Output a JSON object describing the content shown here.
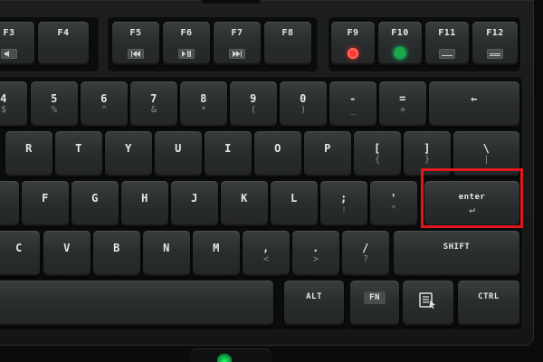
{
  "highlight_target": "enter-key",
  "colors": {
    "highlight": "#e3161d",
    "led_red": "#ff3a30",
    "led_green": "#1aa84a",
    "logo": "#21ff6a"
  },
  "keys": {
    "f3": {
      "label": "F3",
      "icon": "volume-down-icon"
    },
    "f4": {
      "label": "F4"
    },
    "f5": {
      "label": "F5",
      "icon": "previous-track-icon"
    },
    "f6": {
      "label": "F6",
      "icon": "play-pause-icon"
    },
    "f7": {
      "label": "F7",
      "icon": "next-track-icon"
    },
    "f8": {
      "label": "F8"
    },
    "f9": {
      "label": "F9",
      "icon": "record-icon"
    },
    "f10": {
      "label": "F10",
      "icon": "crosshair-icon"
    },
    "f11": {
      "label": "F11",
      "icon": "brightness-down-icon"
    },
    "f12": {
      "label": "F12",
      "icon": "brightness-up-icon"
    },
    "n4": {
      "label": "4",
      "sub": "$"
    },
    "n5": {
      "label": "5",
      "sub": "%"
    },
    "n6": {
      "label": "6",
      "sub": "^"
    },
    "n7": {
      "label": "7",
      "sub": "&"
    },
    "n8": {
      "label": "8",
      "sub": "*"
    },
    "n9": {
      "label": "9",
      "sub": "("
    },
    "n0": {
      "label": "0",
      "sub": ")"
    },
    "minus": {
      "label": "-",
      "sub": "_"
    },
    "equals": {
      "label": "=",
      "sub": "+"
    },
    "backspace": {
      "label": "←"
    },
    "r": {
      "label": "R"
    },
    "t": {
      "label": "T"
    },
    "y": {
      "label": "Y"
    },
    "u": {
      "label": "U"
    },
    "i": {
      "label": "I"
    },
    "o": {
      "label": "O"
    },
    "p": {
      "label": "P"
    },
    "lbracket": {
      "label": "[",
      "sub": "{"
    },
    "rbracket": {
      "label": "]",
      "sub": "}"
    },
    "backslash": {
      "label": "\\",
      "sub": "|"
    },
    "f": {
      "label": "F"
    },
    "g": {
      "label": "G"
    },
    "h": {
      "label": "H"
    },
    "j": {
      "label": "J"
    },
    "k": {
      "label": "K"
    },
    "l": {
      "label": "L"
    },
    "semicolon": {
      "label": ";",
      "sub": ":"
    },
    "quote": {
      "label": "'",
      "sub": "\""
    },
    "enter": {
      "label": "enter",
      "sub": "↵"
    },
    "c": {
      "label": "C"
    },
    "v": {
      "label": "V"
    },
    "b": {
      "label": "B"
    },
    "n": {
      "label": "N"
    },
    "m": {
      "label": "M"
    },
    "comma": {
      "label": ",",
      "sub": "<"
    },
    "period": {
      "label": ".",
      "sub": ">"
    },
    "slash": {
      "label": "/",
      "sub": "?"
    },
    "rshift": {
      "label": "SHIFT"
    },
    "alt": {
      "label": "ALT"
    },
    "fn": {
      "label": "FN"
    },
    "menu": {
      "label": "",
      "icon": "menu-icon"
    },
    "ctrl": {
      "label": "CTRL"
    }
  }
}
